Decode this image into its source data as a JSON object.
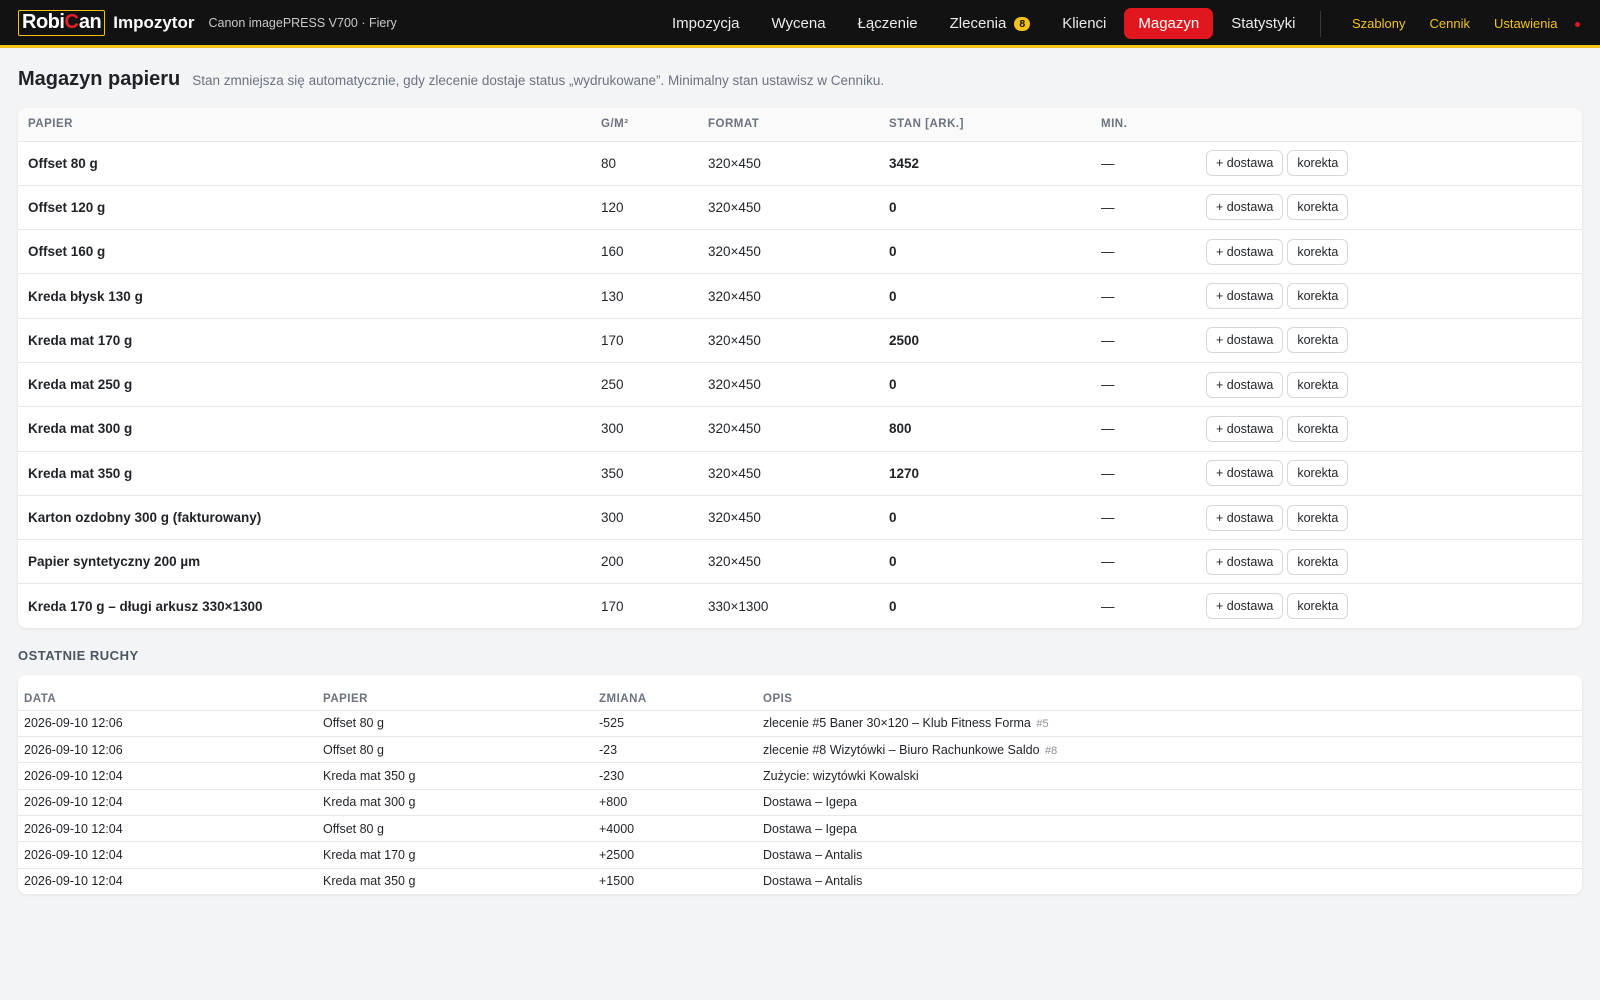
{
  "header": {
    "logo": {
      "part1": "Robi",
      "part2": "C",
      "part3": "an"
    },
    "app_name": "Impozytor",
    "device": "Canon imagePRESS V700 · Fiery",
    "nav": [
      {
        "label": "Impozycja"
      },
      {
        "label": "Wycena"
      },
      {
        "label": "Łączenie"
      },
      {
        "label": "Zlecenia",
        "badge": "8"
      },
      {
        "label": "Klienci"
      },
      {
        "label": "Magazyn",
        "active": true
      },
      {
        "label": "Statystyki"
      }
    ],
    "links": [
      "Szablony",
      "Cennik",
      "Ustawienia"
    ],
    "colors": {
      "accent": "#f2c21b",
      "active": "#e0171f",
      "bar": "#121212"
    }
  },
  "page": {
    "title": "Magazyn papieru",
    "description": "Stan zmniejsza się automatycznie, gdy zlecenie dostaje status „wydrukowane”. Minimalny stan ustawisz w Cenniku."
  },
  "inventory": {
    "columns": [
      "PAPIER",
      "G/M²",
      "FORMAT",
      "STAN [ARK.]",
      "MIN."
    ],
    "actions": {
      "delivery": "+ dostawa",
      "correction": "korekta"
    },
    "rows": [
      {
        "name": "Offset 80 g",
        "gsm": "80",
        "format": "320×450",
        "stock": "3452",
        "min": "—"
      },
      {
        "name": "Offset 120 g",
        "gsm": "120",
        "format": "320×450",
        "stock": "0",
        "min": "—"
      },
      {
        "name": "Offset 160 g",
        "gsm": "160",
        "format": "320×450",
        "stock": "0",
        "min": "—"
      },
      {
        "name": "Kreda błysk 130 g",
        "gsm": "130",
        "format": "320×450",
        "stock": "0",
        "min": "—"
      },
      {
        "name": "Kreda mat 170 g",
        "gsm": "170",
        "format": "320×450",
        "stock": "2500",
        "min": "—"
      },
      {
        "name": "Kreda mat 250 g",
        "gsm": "250",
        "format": "320×450",
        "stock": "0",
        "min": "—"
      },
      {
        "name": "Kreda mat 300 g",
        "gsm": "300",
        "format": "320×450",
        "stock": "800",
        "min": "—"
      },
      {
        "name": "Kreda mat 350 g",
        "gsm": "350",
        "format": "320×450",
        "stock": "1270",
        "min": "—"
      },
      {
        "name": "Karton ozdobny 300 g (fakturowany)",
        "gsm": "300",
        "format": "320×450",
        "stock": "0",
        "min": "—"
      },
      {
        "name": "Papier syntetyczny 200 µm",
        "gsm": "200",
        "format": "320×450",
        "stock": "0",
        "min": "—"
      },
      {
        "name": "Kreda 170 g – długi arkusz 330×1300",
        "gsm": "170",
        "format": "330×1300",
        "stock": "0",
        "min": "—"
      }
    ]
  },
  "movements": {
    "title": "OSTATNIE RUCHY",
    "columns": [
      "DATA",
      "PAPIER",
      "ZMIANA",
      "OPIS"
    ],
    "rows": [
      {
        "date": "2026-09-10 12:06",
        "paper": "Offset 80 g",
        "change": "-525",
        "sign": "neg",
        "desc": "zlecenie #5 Baner 30×120 – Klub Fitness Forma",
        "ref": "#5"
      },
      {
        "date": "2026-09-10 12:06",
        "paper": "Offset 80 g",
        "change": "-23",
        "sign": "neg",
        "desc": "zlecenie #8 Wizytówki – Biuro Rachunkowe Saldo",
        "ref": "#8"
      },
      {
        "date": "2026-09-10 12:04",
        "paper": "Kreda mat 350 g",
        "change": "-230",
        "sign": "neg",
        "desc": "Zużycie: wizytówki Kowalski",
        "ref": ""
      },
      {
        "date": "2026-09-10 12:04",
        "paper": "Kreda mat 300 g",
        "change": "+800",
        "sign": "pos",
        "desc": "Dostawa – Igepa",
        "ref": ""
      },
      {
        "date": "2026-09-10 12:04",
        "paper": "Offset 80 g",
        "change": "+4000",
        "sign": "pos",
        "desc": "Dostawa – Igepa",
        "ref": ""
      },
      {
        "date": "2026-09-10 12:04",
        "paper": "Kreda mat 170 g",
        "change": "+2500",
        "sign": "pos",
        "desc": "Dostawa – Antalis",
        "ref": ""
      },
      {
        "date": "2026-09-10 12:04",
        "paper": "Kreda mat 350 g",
        "change": "+1500",
        "sign": "pos",
        "desc": "Dostawa – Antalis",
        "ref": ""
      }
    ]
  }
}
